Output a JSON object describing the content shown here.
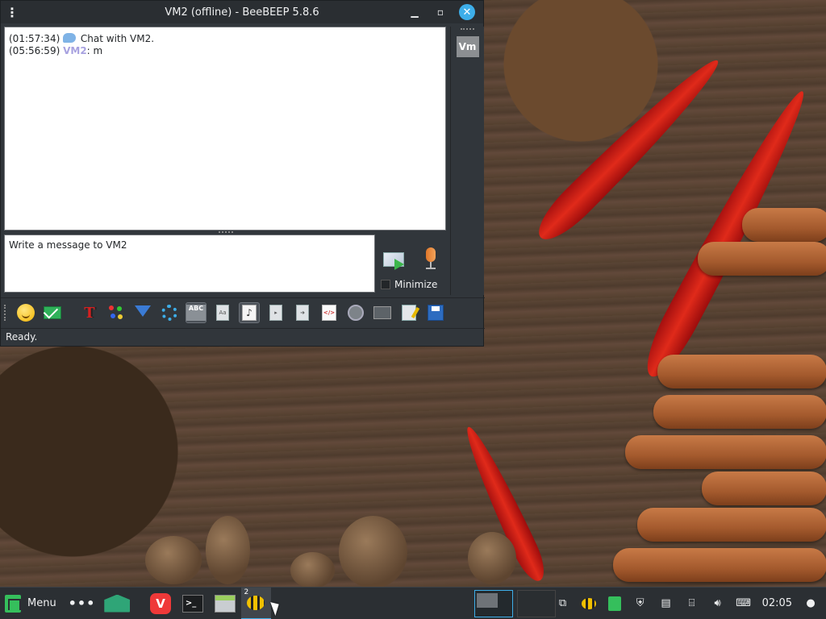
{
  "window": {
    "title": "VM2 (offline) - BeeBEEP 5.8.6",
    "menu_icon": "kebab-menu-icon",
    "controls": [
      "minimize-icon",
      "maximize-icon",
      "close-icon"
    ]
  },
  "chat": {
    "lines": [
      {
        "time": "(01:57:34)",
        "icon": "chat-bubble-icon",
        "text": "Chat with VM2."
      },
      {
        "time": "(05:56:59)",
        "user": "VM2",
        "separator": ":",
        "text": "m"
      }
    ]
  },
  "sidebar": {
    "avatar_label": "Vm"
  },
  "composer": {
    "placeholder": "Write a message to VM2",
    "send_icon": "send-message-icon",
    "voice_icon": "microphone-icon",
    "minimize_label": "Minimize"
  },
  "toolbar": {
    "icons": [
      "emoticons-icon",
      "send-file-icon",
      "font-icon",
      "color-icon",
      "filter-icon",
      "settings-icon",
      "spellcheck-icon",
      "dictionary-icon",
      "note-icon",
      "attach-icon",
      "share-icon",
      "html-icon",
      "record-icon",
      "screenshot-icon",
      "edit-icon",
      "save-chat-icon"
    ]
  },
  "status": {
    "text": "Ready."
  },
  "taskbar": {
    "menu_label": "Menu",
    "bee_badge": "2",
    "clock": "02:05",
    "tray_icons": [
      "beebeep-tray-icon",
      "mint-update-icon",
      "shield-icon",
      "clipboard-icon",
      "network-icon",
      "volume-icon",
      "keyboard-layout-icon",
      "user-icon"
    ]
  },
  "colors": {
    "accent": "#3daee9",
    "user_name": "#a8a2e0",
    "window_bg": "#31363b"
  }
}
